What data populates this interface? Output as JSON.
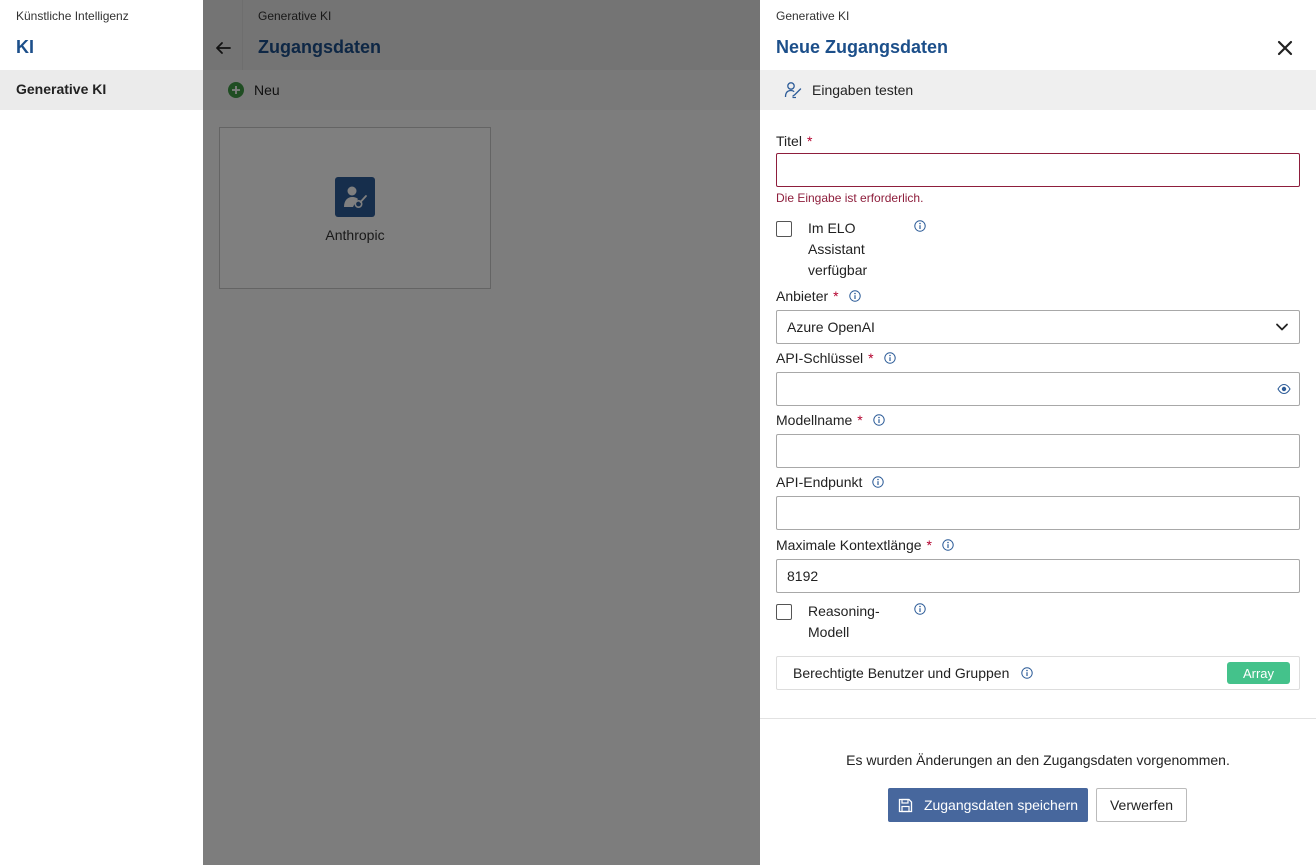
{
  "sidebar": {
    "breadcrumb": "Künstliche Intelligenz",
    "title": "KI",
    "items": [
      {
        "label": "Generative KI"
      }
    ]
  },
  "middle": {
    "breadcrumb": "Generative KI",
    "title": "Zugangsdaten",
    "toolbar": {
      "new_label": "Neu"
    },
    "tiles": [
      {
        "label": "Anthropic"
      }
    ]
  },
  "panel": {
    "breadcrumb": "Generative KI",
    "title": "Neue Zugangsdaten",
    "toolbar": {
      "test_label": "Eingaben testen"
    },
    "form": {
      "title_label": "Titel",
      "title_value": "",
      "title_error": "Die Eingabe ist erforderlich.",
      "required_mark": "*",
      "assistant_label": "Im ELO Assistant verfügbar",
      "assistant_checked": false,
      "provider_label": "Anbieter",
      "provider_value": "Azure OpenAI",
      "api_key_label": "API-Schlüssel",
      "api_key_value": "",
      "model_label": "Modellname",
      "model_value": "",
      "endpoint_label": "API-Endpunkt",
      "endpoint_value": "",
      "context_label": "Maximale Kontextlänge",
      "context_value": "8192",
      "reasoning_label": "Reasoning-Modell",
      "reasoning_checked": false,
      "permissions_label": "Berechtigte Benutzer und Gruppen",
      "permissions_badge": "Array"
    },
    "footer": {
      "changes_text": "Es wurden Änderungen an den Zugangsdaten vorgenommen.",
      "save_label": "Zugangsdaten speichern",
      "discard_label": "Verwerfen"
    }
  },
  "colors": {
    "title_blue": "#1c4f8a",
    "error": "#8e1e3c",
    "primary_button": "#47679d",
    "badge_green": "#44c28b",
    "new_green": "#3e9a45"
  }
}
